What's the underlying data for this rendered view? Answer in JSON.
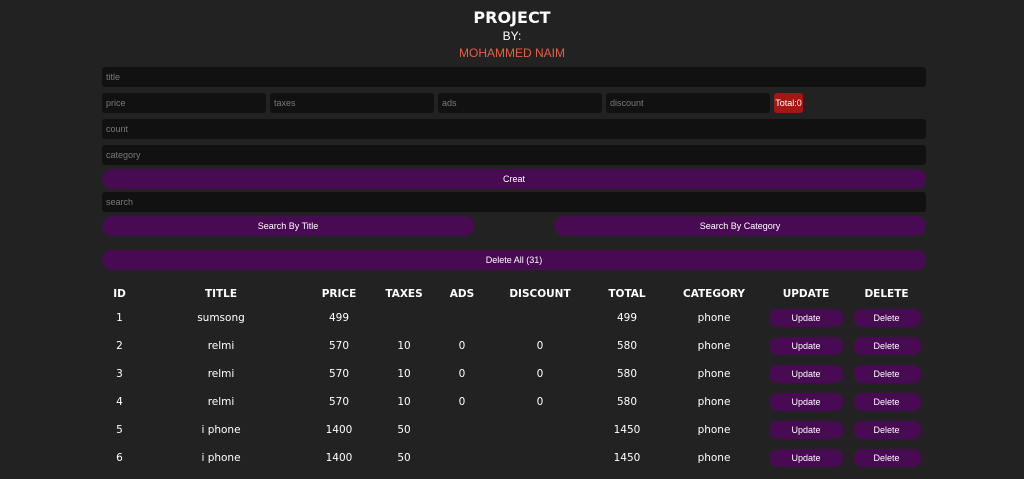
{
  "header": {
    "title": "PROJECT",
    "by": "BY:",
    "author": "MOHAMMED NAIM"
  },
  "colors": {
    "background": "#222222",
    "input": "#111111",
    "button": "#480a52",
    "total": "#a61414",
    "author": "#e85d45"
  },
  "form": {
    "title_placeholder": "title",
    "price_placeholder": "price",
    "taxes_placeholder": "taxes",
    "ads_placeholder": "ads",
    "discount_placeholder": "discount",
    "total_label": "Total:0",
    "count_placeholder": "count",
    "category_placeholder": "category",
    "create_label": "Creat",
    "search_placeholder": "search",
    "search_title_label": "Search By Title",
    "search_category_label": "Search By Category",
    "delete_all_label": "Delete All (31)"
  },
  "table": {
    "headers": [
      "ID",
      "TITLE",
      "PRICE",
      "TAXES",
      "ADS",
      "DISCOUNT",
      "TOTAL",
      "CATEGORY",
      "UPDATE",
      "DELETE"
    ],
    "update_label": "Update",
    "delete_label": "Delete",
    "rows": [
      {
        "id": "1",
        "title": "sumsong",
        "price": "499",
        "taxes": "",
        "ads": "",
        "discount": "",
        "total": "499",
        "category": "phone"
      },
      {
        "id": "2",
        "title": "relmi",
        "price": "570",
        "taxes": "10",
        "ads": "0",
        "discount": "0",
        "total": "580",
        "category": "phone"
      },
      {
        "id": "3",
        "title": "relmi",
        "price": "570",
        "taxes": "10",
        "ads": "0",
        "discount": "0",
        "total": "580",
        "category": "phone"
      },
      {
        "id": "4",
        "title": "relmi",
        "price": "570",
        "taxes": "10",
        "ads": "0",
        "discount": "0",
        "total": "580",
        "category": "phone"
      },
      {
        "id": "5",
        "title": "i phone",
        "price": "1400",
        "taxes": "50",
        "ads": "",
        "discount": "",
        "total": "1450",
        "category": "phone"
      },
      {
        "id": "6",
        "title": "i phone",
        "price": "1400",
        "taxes": "50",
        "ads": "",
        "discount": "",
        "total": "1450",
        "category": "phone"
      }
    ]
  }
}
